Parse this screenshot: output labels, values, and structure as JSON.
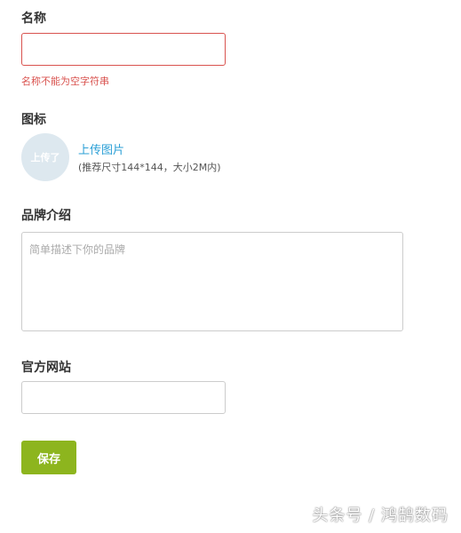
{
  "form": {
    "name": {
      "label": "名称",
      "value": "",
      "error": "名称不能为空字符串"
    },
    "icon": {
      "label": "图标",
      "avatar_text": "上传了",
      "upload_label": "上传图片",
      "hint": "(推荐尺寸144*144，大小2M内)"
    },
    "brand_intro": {
      "label": "品牌介绍",
      "placeholder": "简单描述下你的品牌",
      "value": ""
    },
    "website": {
      "label": "官方网站",
      "value": ""
    },
    "save_label": "保存"
  },
  "watermark": "头条号 / 鸿鹄数码",
  "colors": {
    "error": "#d9534f",
    "link": "#2a9fd6",
    "save_button": "#8db51e",
    "avatar_bg": "#dde8ef"
  }
}
